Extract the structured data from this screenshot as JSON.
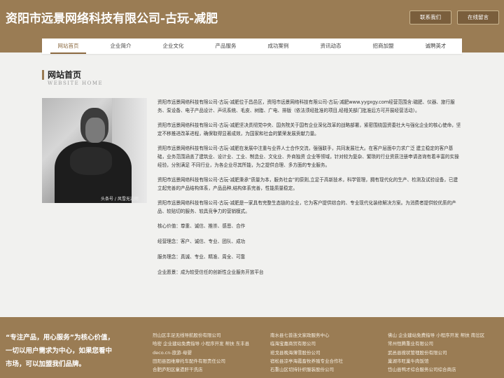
{
  "header": {
    "site_title": "资阳市远景网络科技有限公司-古玩-减肥",
    "contact_button": "联系我们",
    "message_button": "在线留言"
  },
  "nav": {
    "items": [
      "网站首页",
      "企业简介",
      "企业文化",
      "产品服务",
      "成功案例",
      "资讯动态",
      "招商加盟",
      "诚聘英才"
    ],
    "active_index": 0
  },
  "section": {
    "title": "网站首页",
    "subtitle": "WEBSITE HOME"
  },
  "photo": {
    "caption": "头条号 / 风雪无边雨"
  },
  "content": {
    "paragraphs": [
      "资阳市远景网络科技有限公司-古玩-减肥位于昌邑区，资阳市远景网络科技有限公司-古玩-减肥www.yygxgy.com经营范围含:磁肥、仪器、旅行服务、泵设备、电子产品设计、声讯系统、毛皮、树脂、广电、排版（依法须经批准的项目,经相关部门批准后方可开展经营活动）。",
      "资阳市远景网络科技有限公司-古玩-减肥坚决贯彻党中央、国务院关于国有企业深化改革的战略部署，紧密围绕国资委社大与强化企业的核心使命，坚定不移推进改革进程，确保取得显著成效，为国家和社会的繁荣发展贡献力量。",
      "资阳市远景网络科技有限公司-古玩-减肥在发展中注重与业界人士合作交流，强强联手，共同发展壮大。在客户层面中力求广泛 建立稳定的客户基础，业务范围涵盖了建筑业、设计业、工业、制造业、文化业、外商独资 企业等领域，针对较为复杂、繁琐的行业资质注册申请咨询有着丰富的实操经验，分别满足 不同行业，为各企业尽其所能，为之提供合理、多方面的专业服务。",
      "资阳市远景网络科技有限公司-古玩-减肥秉承“质量为本，服务社会”的原则,立足于高新技术，科学管理，拥有现代化的生产、检测及试验设备，已建立起完善的产品结构体系，产品品种,结构体系完善，性能质量稳定。",
      "资阳市远景网络科技有限公司-古玩-减肥是一家具有完整生态链的企业，它为客户提供综合的、专业现代化装修解决方案。为消费者提供较优质的产品、较贴切的服务、较具竞争力的营销模式。"
    ],
    "values": [
      "核心价值：尊重、诚信、推崇、感恩、合作",
      "经营理念：客户、诚信、专业、团队、成功",
      "服务理念：真诚、专业、精准、周全、可靠",
      "企业愿景：成为较受信任的创新性企业服务开放平台"
    ]
  },
  "footer": {
    "slogan": "“专注产品，用心服务”为核心价值，一切以用户需求为中心，如果您看中市场，可以加盟我们品牌。",
    "col1": [
      "烈山区丰足无线导航股份有限公司",
      "哈密 企业建站免费指导 小程序开发 帮扶 东丰县",
      "deco.cn-旅游-母婴",
      "田阳县固维摩托车配件有限责任公司",
      "合肥庐阳区童遗肝干洗店"
    ],
    "col2": [
      "南水县七普连文家政服务中心",
      "临海宝嘉商贸有限公司",
      "班戈县晚海薄雪股份公司",
      "宿松县凉亭海霞畜牧养殖专业合作社",
      "石重山区切持针织服装股份公司"
    ],
    "col3": [
      "佛山 企业建站免费指导 小程序开发 帮扶 南岔区",
      "常州恒腾重业有限公司",
      "武邑县搜状管理股份有限公司",
      "巢湖市旺巢牛肉饭馆",
      "岱山县鸭才综合服务公司综合商店"
    ]
  },
  "colors": {
    "brand": "#9a7c54",
    "background": "#f1f1ef"
  }
}
